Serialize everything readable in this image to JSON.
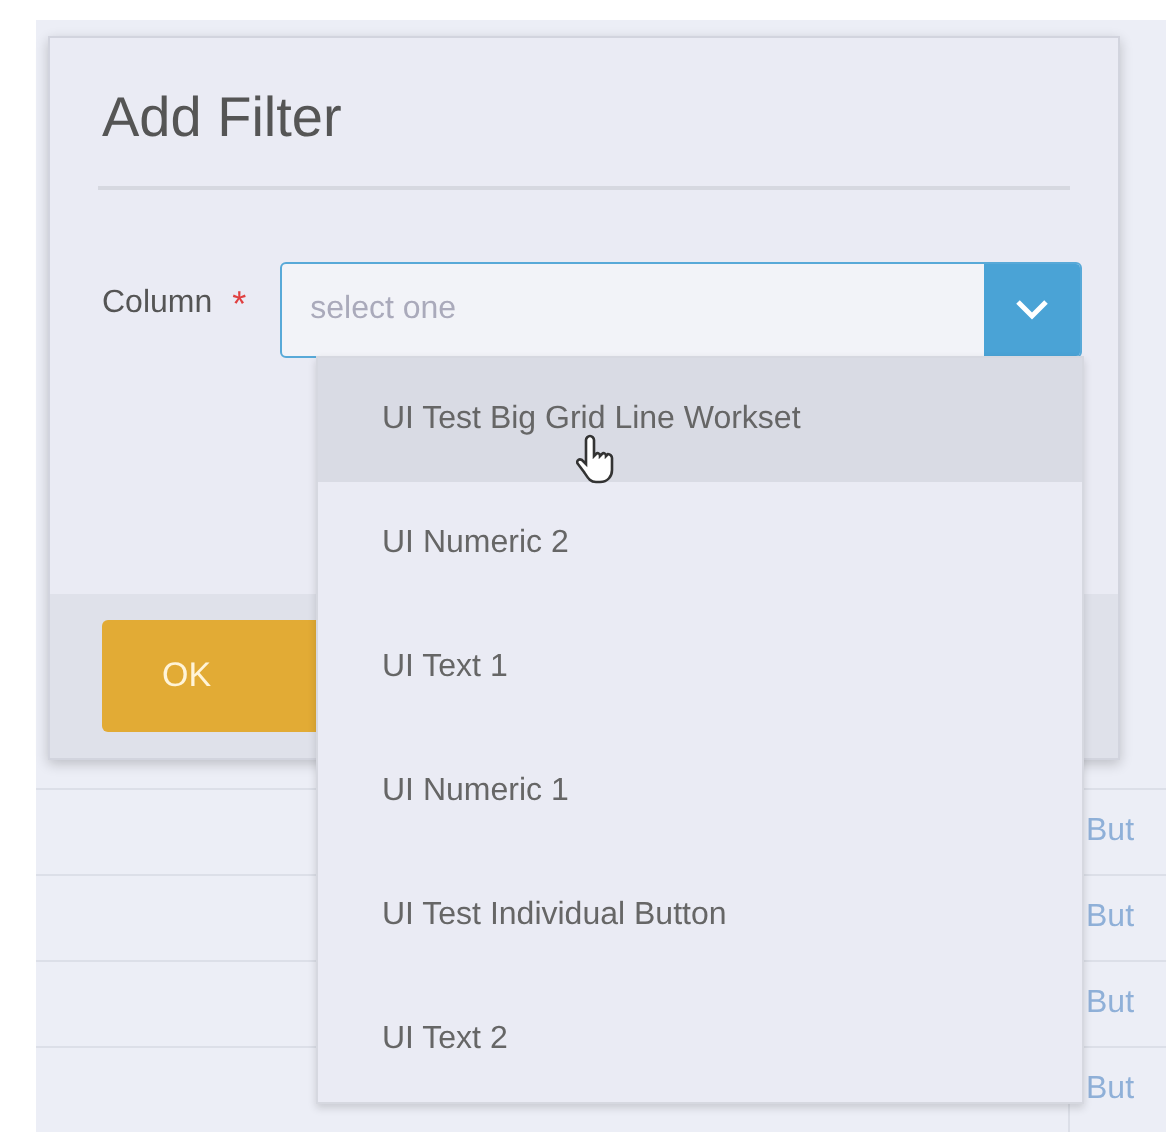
{
  "background_grid": {
    "rows": [
      {
        "column_3": "But"
      },
      {
        "column_3": "But"
      },
      {
        "column_3": "But"
      },
      {
        "column_3": "But"
      }
    ]
  },
  "dialog": {
    "title": "Add Filter",
    "field": {
      "label": "Column",
      "required": true,
      "required_mark": "*",
      "placeholder": "select one",
      "expanded": true
    },
    "options": [
      {
        "label": "UI Test Big Grid Line Workset",
        "selected": true
      },
      {
        "label": "UI Numeric 2",
        "selected": false
      },
      {
        "label": "UI Text 1",
        "selected": false
      },
      {
        "label": "UI Numeric 1",
        "selected": false
      },
      {
        "label": "UI Test Individual Button",
        "selected": false
      },
      {
        "label": "UI Text 2",
        "selected": false
      }
    ],
    "buttons": [
      {
        "label": "OK",
        "kind": "primary"
      }
    ]
  }
}
